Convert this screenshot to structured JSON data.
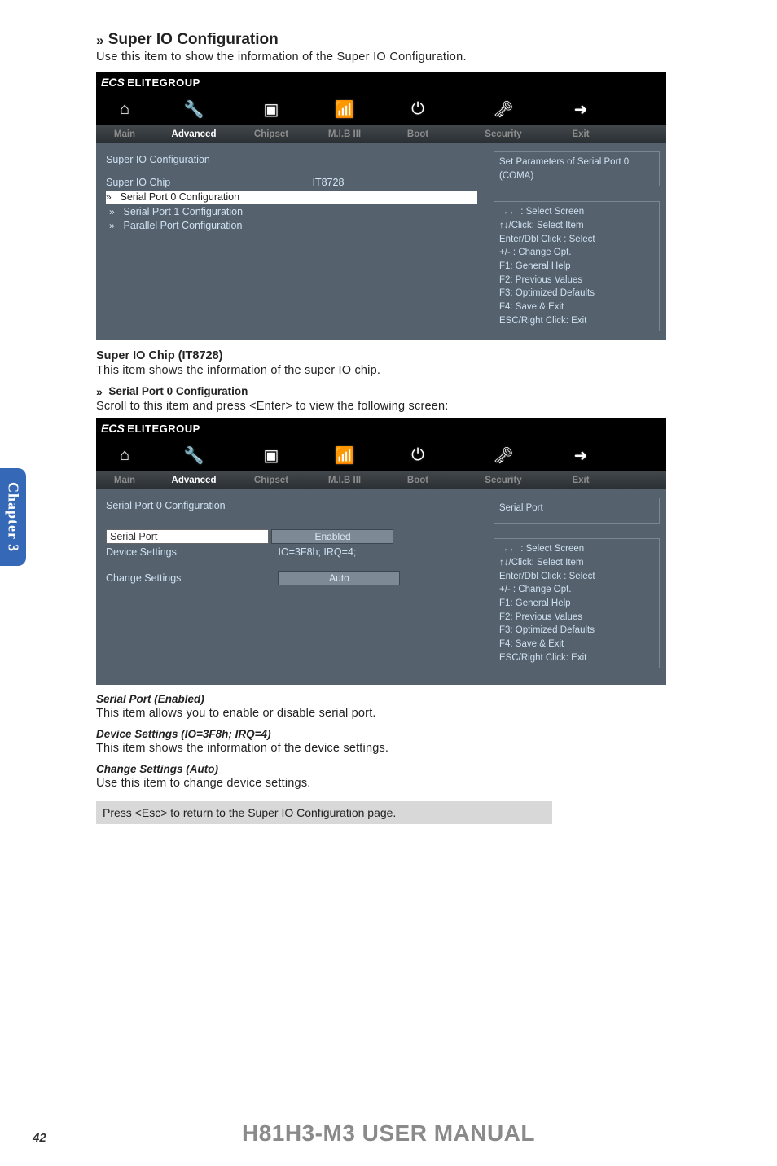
{
  "sideTab": "Chapter 3",
  "sectionTitle": "Super IO Configuration",
  "sectionDesc": "Use this item to show the information of the Super IO Configuration.",
  "bios1": {
    "brand_a": "ECS",
    "brand_b": "ELITEGROUP",
    "tabs": {
      "main": "Main",
      "advanced": "Advanced",
      "chipset": "Chipset",
      "mib": "M.I.B III",
      "boot": "Boot",
      "security": "Security",
      "exit": "Exit"
    },
    "title": "Super IO Configuration",
    "chip_label": "Super IO Chip",
    "chip_val": "IT8728",
    "items": [
      "Serial Port 0 Configuration",
      "Serial Port 1 Configuration",
      "Parallel Port Configuration"
    ],
    "info": "Set Parameters of Serial Port 0 (COMA)",
    "help": [
      "→←  : Select Screen",
      "↑↓/Click: Select Item",
      "Enter/Dbl Click : Select",
      "+/- : Change Opt.",
      "F1: General Help",
      "F2: Previous Values",
      "F3: Optimized Defaults",
      "F4: Save & Exit",
      "ESC/Right Click: Exit"
    ]
  },
  "sub1_head": "Super IO Chip (IT8728)",
  "sub1_body": "This item shows the information of the super IO chip.",
  "sub2_head": "Serial Port 0 Configuration",
  "sub2_body": "Scroll to this item and press <Enter> to view the following screen:",
  "bios2": {
    "title": "Serial Port 0 Configuration",
    "rows": {
      "sp_label": "Serial Port",
      "sp_val": "Enabled",
      "ds_label": "Device Settings",
      "ds_val": "IO=3F8h;  IRQ=4;",
      "cs_label": "Change Settings",
      "cs_val": "Auto"
    },
    "info": "Serial Port"
  },
  "sp_head": "Serial Port (Enabled)",
  "sp_body": "This item allows you to enable or disable serial port.",
  "ds_head": "Device Settings (IO=3F8h; IRQ=4)",
  "ds_body": "This item shows the information of the device settings.",
  "cs_head": "Change Settings (Auto)",
  "cs_body": "Use this item to change device settings.",
  "note": "Press <Esc> to return to the Super IO Configuration page.",
  "footer": "H81H3-M3 USER MANUAL",
  "pageNum": "42"
}
